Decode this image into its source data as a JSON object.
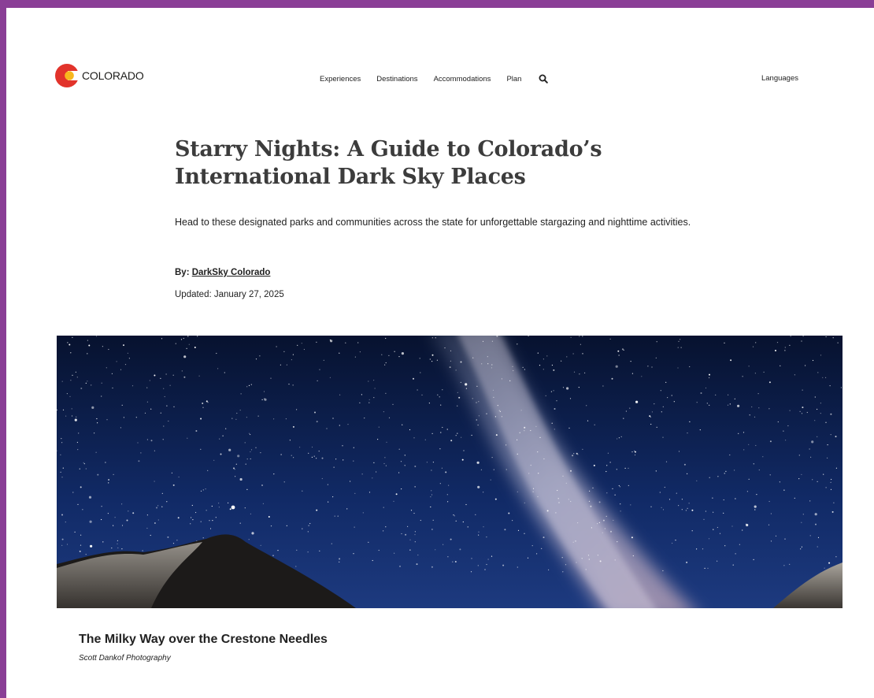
{
  "brand": {
    "name": "COLORADO",
    "logo_icon": "colorado-c-logo",
    "colors": {
      "red": "#e2332b",
      "yellow": "#f8b81d",
      "frame": "#8a3e96"
    }
  },
  "nav": {
    "items": [
      "Experiences",
      "Destinations",
      "Accommodations",
      "Plan"
    ],
    "search_icon": "search-icon",
    "languages": "Languages"
  },
  "article": {
    "title": "Starry Nights: A Guide to Colorado’s International Dark Sky Places",
    "subtitle": "Head to these designated parks and communities across the state for unforgettable stargazing and nighttime activities.",
    "byline_prefix": "By:",
    "author": "DarkSky Colorado",
    "updated": "Updated: January 27, 2025"
  },
  "hero": {
    "caption_title": "The Milky Way over the Crestone Needles",
    "caption_credit": "Scott Dankof Photography"
  }
}
